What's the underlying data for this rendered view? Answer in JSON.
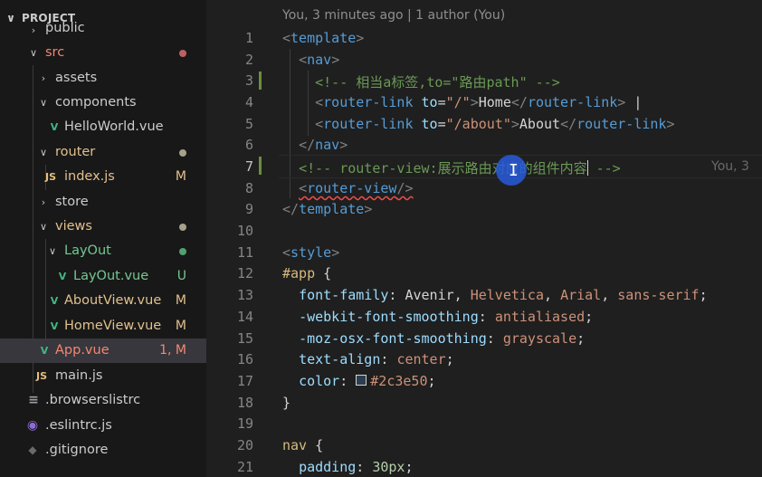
{
  "explorer": {
    "title": "PROJECT",
    "items": [
      {
        "label": "public",
        "kind": "folder"
      },
      {
        "label": "src",
        "kind": "folder",
        "dot": "#c06060"
      },
      {
        "label": "assets",
        "kind": "folder"
      },
      {
        "label": "components",
        "kind": "folder"
      },
      {
        "label": "HelloWorld.vue",
        "kind": "vue"
      },
      {
        "label": "router",
        "kind": "folder",
        "dot": "#a5a28a"
      },
      {
        "label": "index.js",
        "kind": "js",
        "badge": "M"
      },
      {
        "label": "store",
        "kind": "folder"
      },
      {
        "label": "views",
        "kind": "folder",
        "dot": "#a5a28a"
      },
      {
        "label": "LayOut",
        "kind": "folder",
        "dot": "#52a171"
      },
      {
        "label": "LayOut.vue",
        "kind": "vue",
        "badge": "U"
      },
      {
        "label": "AboutView.vue",
        "kind": "vue",
        "badge": "M"
      },
      {
        "label": "HomeView.vue",
        "kind": "vue",
        "badge": "M"
      },
      {
        "label": "App.vue",
        "kind": "vue",
        "badge": "1, M",
        "active": true
      },
      {
        "label": "main.js",
        "kind": "js"
      },
      {
        "label": ".browserslistrc",
        "kind": "file"
      },
      {
        "label": ".eslintrc.js",
        "kind": "eslint"
      },
      {
        "label": ".gitignore",
        "kind": "git"
      }
    ],
    "icons": {
      "js": "JS",
      "vue": "V",
      "file": "≡",
      "eslint": "◉",
      "git": "◆",
      "chevron_down": "∨",
      "chevron_right": "›"
    },
    "colors": {
      "text_untracked": "#73c991",
      "text_modified": "#e2c08d",
      "text_error": "#f48771"
    }
  },
  "editor": {
    "blame_header": "You, 3 minutes ago | 1 author (You)",
    "inline_blame": "You, 3",
    "line_numbers": [
      "1",
      "2",
      "3",
      "4",
      "5",
      "6",
      "7",
      "8",
      "9",
      "10",
      "11",
      "12",
      "13",
      "14",
      "15",
      "16",
      "17",
      "18",
      "19",
      "20",
      "21"
    ],
    "code": {
      "l1_tag": "template",
      "l2_tag": "nav",
      "l3_comment": "<!-- 相当a标签,to=\"路由path\" -->",
      "l4_tag": "router-link",
      "l4_attr": "to",
      "l4_val": "\"/\"",
      "l4_text": "Home",
      "l5_tag": "router-link",
      "l5_attr": "to",
      "l5_val": "\"/about\"",
      "l5_text": "About",
      "l6_tag": "nav",
      "l7_comment_a": "<!-- router-view:展示路由对应的组件内容",
      "l7_comment_b": " -->",
      "l8_tag": "router-view",
      "l9_tag": "template",
      "l11_tag": "style",
      "l12_selector": "#app",
      "l13_prop": "font-family",
      "l13_v1": "Avenir",
      "l13_v2": "Helvetica",
      "l13_v3": "Arial",
      "l13_v4": "sans-serif",
      "l14_prop": "-webkit-font-smoothing",
      "l14_val": "antialiased",
      "l15_prop": "-moz-osx-font-smoothing",
      "l15_val": "grayscale",
      "l16_prop": "text-align",
      "l16_val": "center",
      "l17_prop": "color",
      "l17_val": "#2c3e50",
      "l18_close": "}",
      "l20_selector": "nav",
      "l21_prop": "padding",
      "l21_val": "30px"
    }
  }
}
